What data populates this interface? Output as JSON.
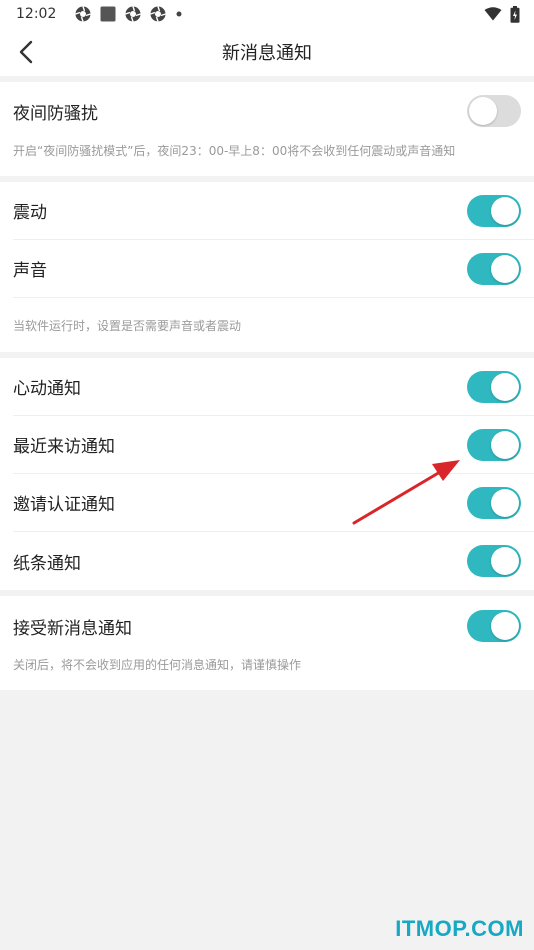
{
  "status_bar": {
    "time": "12:02",
    "icons": [
      "aperture-icon",
      "square-icon",
      "aperture-icon",
      "aperture-icon",
      "dot-icon"
    ],
    "right_icons": [
      "wifi-icon",
      "battery-icon"
    ]
  },
  "app_bar": {
    "title": "新消息通知",
    "back_icon": "chevron-left-icon"
  },
  "night_section": {
    "label": "夜间防骚扰",
    "enabled": false,
    "hint": "开启“夜间防骚扰模式”后，夜间23：00-早上8：00将不会收到任何震动或声音通知"
  },
  "alert_section": {
    "vibrate": {
      "label": "震动",
      "enabled": true
    },
    "sound": {
      "label": "声音",
      "enabled": true
    },
    "hint": "当软件运行时，设置是否需要声音或者震动"
  },
  "notify_section": {
    "items": [
      {
        "label": "心动通知",
        "enabled": true
      },
      {
        "label": "最近来访通知",
        "enabled": true
      },
      {
        "label": "邀请认证通知",
        "enabled": true
      },
      {
        "label": "纸条通知",
        "enabled": true
      }
    ]
  },
  "receive_section": {
    "label": "接受新消息通知",
    "enabled": true,
    "hint": "关闭后，将不会收到应用的任何消息通知，请谨慎操作"
  },
  "colors": {
    "toggle_on": "#2fb8bf",
    "toggle_off": "#dcdcdc",
    "arrow": "#d9262a",
    "watermark": "#17a8c4"
  },
  "watermark": "ITMOP.COM"
}
